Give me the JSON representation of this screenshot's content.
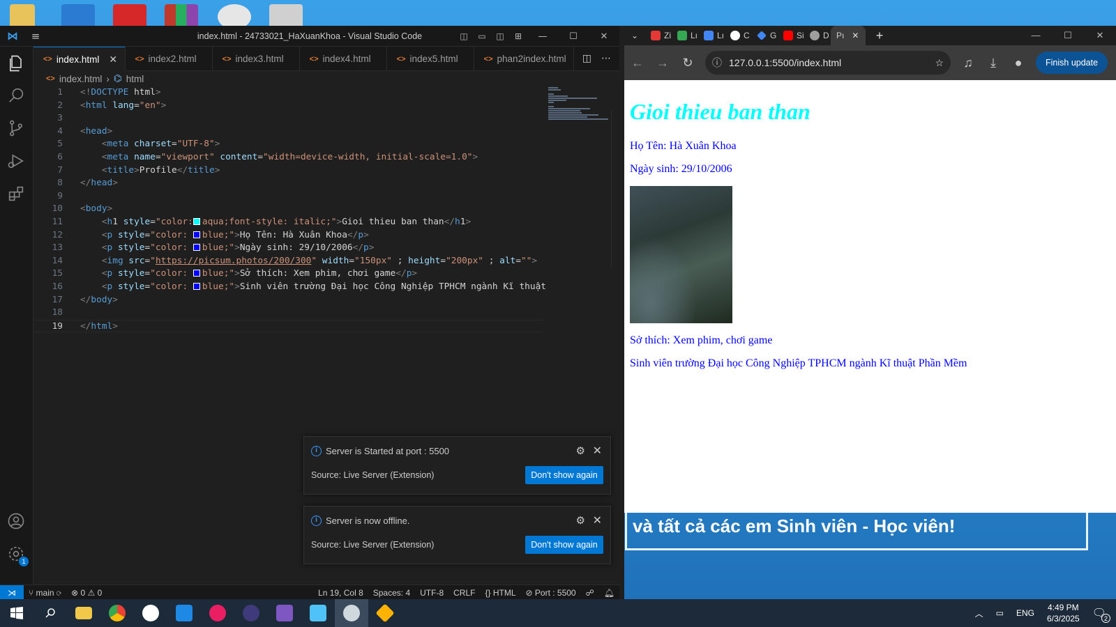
{
  "desktop": {
    "banner_text": "và tất cả các em Sinh viên - Học viên!"
  },
  "vscode": {
    "title": "index.html - 24733021_HaXuanKhoa - Visual Studio Code",
    "tabs": [
      {
        "label": "index.html",
        "active": true
      },
      {
        "label": "index2.html"
      },
      {
        "label": "index3.html"
      },
      {
        "label": "index4.html"
      },
      {
        "label": "index5.html"
      },
      {
        "label": "phan2index.html"
      }
    ],
    "breadcrumb": {
      "file": "index.html",
      "symbol": "html"
    },
    "code_lines": [
      {
        "n": "1",
        "t": "<!DOCTYPE html>"
      },
      {
        "n": "2",
        "t": "<html lang=\"en\">"
      },
      {
        "n": "3",
        "t": ""
      },
      {
        "n": "4",
        "t": "<head>"
      },
      {
        "n": "5",
        "t": "    <meta charset=\"UTF-8\">"
      },
      {
        "n": "6",
        "t": "    <meta name=\"viewport\" content=\"width=device-width, initial-scale=1.0\">"
      },
      {
        "n": "7",
        "t": "    <title>Profile</title>"
      },
      {
        "n": "8",
        "t": "</head>"
      },
      {
        "n": "9",
        "t": ""
      },
      {
        "n": "10",
        "t": "<body>"
      },
      {
        "n": "11",
        "t": "    <h1 style=\"color:aqua;font-style: italic;\">Gioi thieu ban than</h1>"
      },
      {
        "n": "12",
        "t": "    <p style=\"color: blue;\">Họ Tên: Hà Xuân Khoa</p>"
      },
      {
        "n": "13",
        "t": "    <p style=\"color: blue;\">Ngày sinh: 29/10/2006</p>"
      },
      {
        "n": "14",
        "t": "    <img src=\"https://picsum.photos/200/300\" width=\"150px\" ; height=\"200px\" ; alt=\"\">"
      },
      {
        "n": "15",
        "t": "    <p style=\"color: blue;\">Sở thích: Xem phim, chơi game</p>"
      },
      {
        "n": "16",
        "t": "    <p style=\"color: blue;\">Sinh viên trường Đại học Công Nghiệp TPHCM ngành Kĩ thuật"
      },
      {
        "n": "17",
        "t": "</body>"
      },
      {
        "n": "18",
        "t": ""
      },
      {
        "n": "19",
        "t": "</html>"
      }
    ],
    "notifications": [
      {
        "message": "Server is Started at port : 5500",
        "source": "Source: Live Server (Extension)",
        "button": "Don't show again"
      },
      {
        "message": "Server is now offline.",
        "source": "Source: Live Server (Extension)",
        "button": "Don't show again"
      }
    ],
    "status": {
      "branch": "main",
      "problems": "⊗ 0 ⚠ 0",
      "position": "Ln 19, Col 8",
      "spaces": "Spaces: 4",
      "encoding": "UTF-8",
      "eol": "CRLF",
      "language": "HTML",
      "port": "Port : 5500",
      "settings_badge": "1"
    }
  },
  "chrome": {
    "tabs": [
      {
        "label": "Zi",
        "color": "#e53935"
      },
      {
        "label": "Lı",
        "color": "#34a853"
      },
      {
        "label": "Lı",
        "color": "#4285f4"
      },
      {
        "label": "C",
        "color": "#ffffff"
      },
      {
        "label": "G",
        "color": "#4285f4"
      },
      {
        "label": "Si",
        "color": "#ff0000"
      },
      {
        "label": "D",
        "color": "#9e9e9e"
      },
      {
        "label": "Pı",
        "color": "#9e9e9e"
      }
    ],
    "url": "127.0.0.1:5500/index.html",
    "finish_update": "Finish update",
    "page": {
      "heading": "Gioi thieu ban than",
      "name": "Họ Tên: Hà Xuân Khoa",
      "dob": "Ngày sinh: 29/10/2006",
      "hobby": "Sở thích: Xem phim, chơi game",
      "school": "Sinh viên trường Đại học Công Nghiệp TPHCM ngành Kĩ thuật Phần Mềm"
    }
  },
  "taskbar": {
    "lang": "ENG",
    "time": "4:49 PM",
    "date": "6/3/2025",
    "notif_count": "2"
  }
}
